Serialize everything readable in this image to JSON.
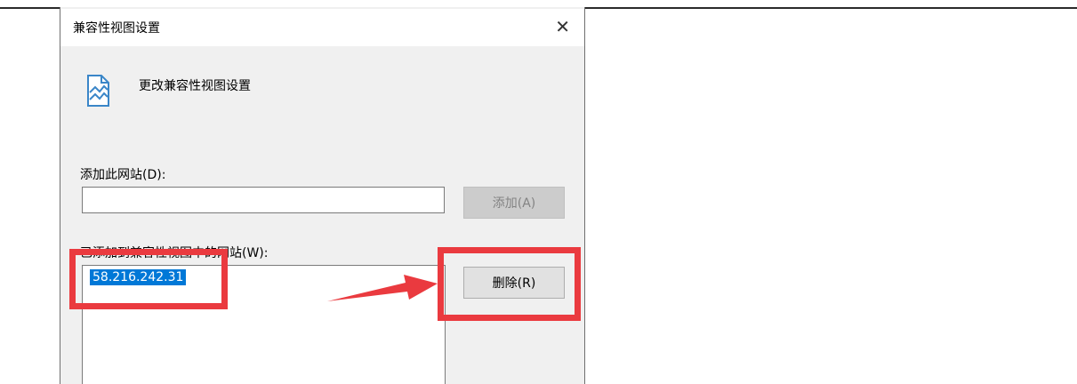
{
  "dialog": {
    "title": "兼容性视图设置",
    "close_glyph": "✕",
    "heading": "更改兼容性视图设置",
    "heading_icon": "compat-view-page-icon",
    "add_site_label": "添加此网站(D):",
    "add_site_value": "",
    "add_button_label": "添加(A)",
    "added_sites_label": "已添加到兼容性视图中的网站(W):",
    "added_sites": [
      "58.216.242.31"
    ],
    "remove_button_label": "删除(R)"
  },
  "annotations": {
    "highlight_color": "#ea3a3f",
    "arrow_icon": "red-arrow-right"
  }
}
